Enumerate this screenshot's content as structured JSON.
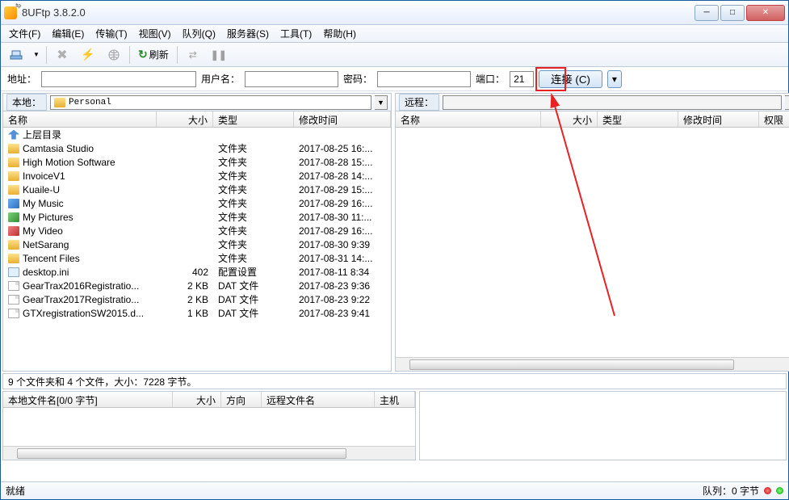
{
  "title": "8UFtp 3.8.2.0",
  "menus": [
    "文件(F)",
    "编辑(E)",
    "传输(T)",
    "视图(V)",
    "队列(Q)",
    "服务器(S)",
    "工具(T)",
    "帮助(H)"
  ],
  "toolbar": {
    "refresh_label": "刷新"
  },
  "conn": {
    "addr_label": "地址：",
    "addr": "",
    "user_label": "用户名：",
    "user": "",
    "pass_label": "密码：",
    "pass": "",
    "port_label": "端口：",
    "port": "21",
    "connect_label": "连接 (C)"
  },
  "local": {
    "label": "本地：",
    "path": "Personal",
    "cols": {
      "name": "名称",
      "size": "大小",
      "type": "类型",
      "date": "修改时间"
    },
    "rows": [
      {
        "icon": "up",
        "name": "上层目录",
        "size": "",
        "type": "",
        "date": ""
      },
      {
        "icon": "folder",
        "name": "Camtasia Studio",
        "size": "",
        "type": "文件夹",
        "date": "2017-08-25 16:..."
      },
      {
        "icon": "folder",
        "name": "High Motion Software",
        "size": "",
        "type": "文件夹",
        "date": "2017-08-28 15:..."
      },
      {
        "icon": "folder",
        "name": "InvoiceV1",
        "size": "",
        "type": "文件夹",
        "date": "2017-08-28 14:..."
      },
      {
        "icon": "folder",
        "name": "Kuaile-U",
        "size": "",
        "type": "文件夹",
        "date": "2017-08-29 15:..."
      },
      {
        "icon": "music",
        "name": "My Music",
        "size": "",
        "type": "文件夹",
        "date": "2017-08-29 16:..."
      },
      {
        "icon": "pic",
        "name": "My Pictures",
        "size": "",
        "type": "文件夹",
        "date": "2017-08-30 11:..."
      },
      {
        "icon": "vid",
        "name": "My Video",
        "size": "",
        "type": "文件夹",
        "date": "2017-08-29 16:..."
      },
      {
        "icon": "folder",
        "name": "NetSarang",
        "size": "",
        "type": "文件夹",
        "date": "2017-08-30 9:39"
      },
      {
        "icon": "folder",
        "name": "Tencent Files",
        "size": "",
        "type": "文件夹",
        "date": "2017-08-31 14:..."
      },
      {
        "icon": "ini",
        "name": "desktop.ini",
        "size": "402",
        "type": "配置设置",
        "date": "2017-08-11 8:34"
      },
      {
        "icon": "file",
        "name": "GearTrax2016Registratio...",
        "size": "2 KB",
        "type": "DAT 文件",
        "date": "2017-08-23 9:36"
      },
      {
        "icon": "file",
        "name": "GearTrax2017Registratio...",
        "size": "2 KB",
        "type": "DAT 文件",
        "date": "2017-08-23 9:22"
      },
      {
        "icon": "file",
        "name": "GTXregistrationSW2015.d...",
        "size": "1 KB",
        "type": "DAT 文件",
        "date": "2017-08-23 9:41"
      }
    ]
  },
  "remote": {
    "label": "远程：",
    "path": "",
    "cols": {
      "name": "名称",
      "size": "大小",
      "type": "类型",
      "date": "修改时间",
      "perm": "权限"
    }
  },
  "summary": "9 个文件夹和 4 个文件，大小：7228 字节。",
  "queue": {
    "cols": {
      "file": "本地文件名[0/0 字节]",
      "size": "大小",
      "dir": "方向",
      "remote": "远程文件名",
      "host": "主机"
    }
  },
  "status": {
    "ready": "就绪",
    "queue": "队列：0 字节"
  }
}
